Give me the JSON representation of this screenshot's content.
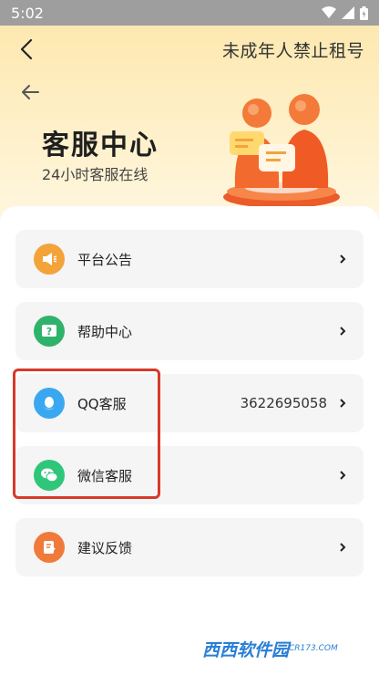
{
  "status_bar": {
    "time": "5:02"
  },
  "nav": {
    "title": "未成年人禁止租号"
  },
  "hero": {
    "title": "客服中心",
    "subtitle": "24小时客服在线"
  },
  "colors": {
    "accent_orange": "#f3a33a",
    "green": "#2fb36b",
    "qq_blue": "#3aa8f0",
    "wechat_green": "#2fc67a",
    "feedback_orange": "#f07a3a",
    "highlight_red": "#d63a2a"
  },
  "items": [
    {
      "label": "平台公告",
      "icon": "megaphone-icon",
      "value": ""
    },
    {
      "label": "帮助中心",
      "icon": "question-icon",
      "value": ""
    },
    {
      "label": "QQ客服",
      "icon": "qq-icon",
      "value": "3622695058"
    },
    {
      "label": "微信客服",
      "icon": "wechat-icon",
      "value": ""
    },
    {
      "label": "建议反馈",
      "icon": "feedback-icon",
      "value": ""
    }
  ],
  "watermark": {
    "text": "西西软件园",
    "sub": "CR173.COM"
  }
}
